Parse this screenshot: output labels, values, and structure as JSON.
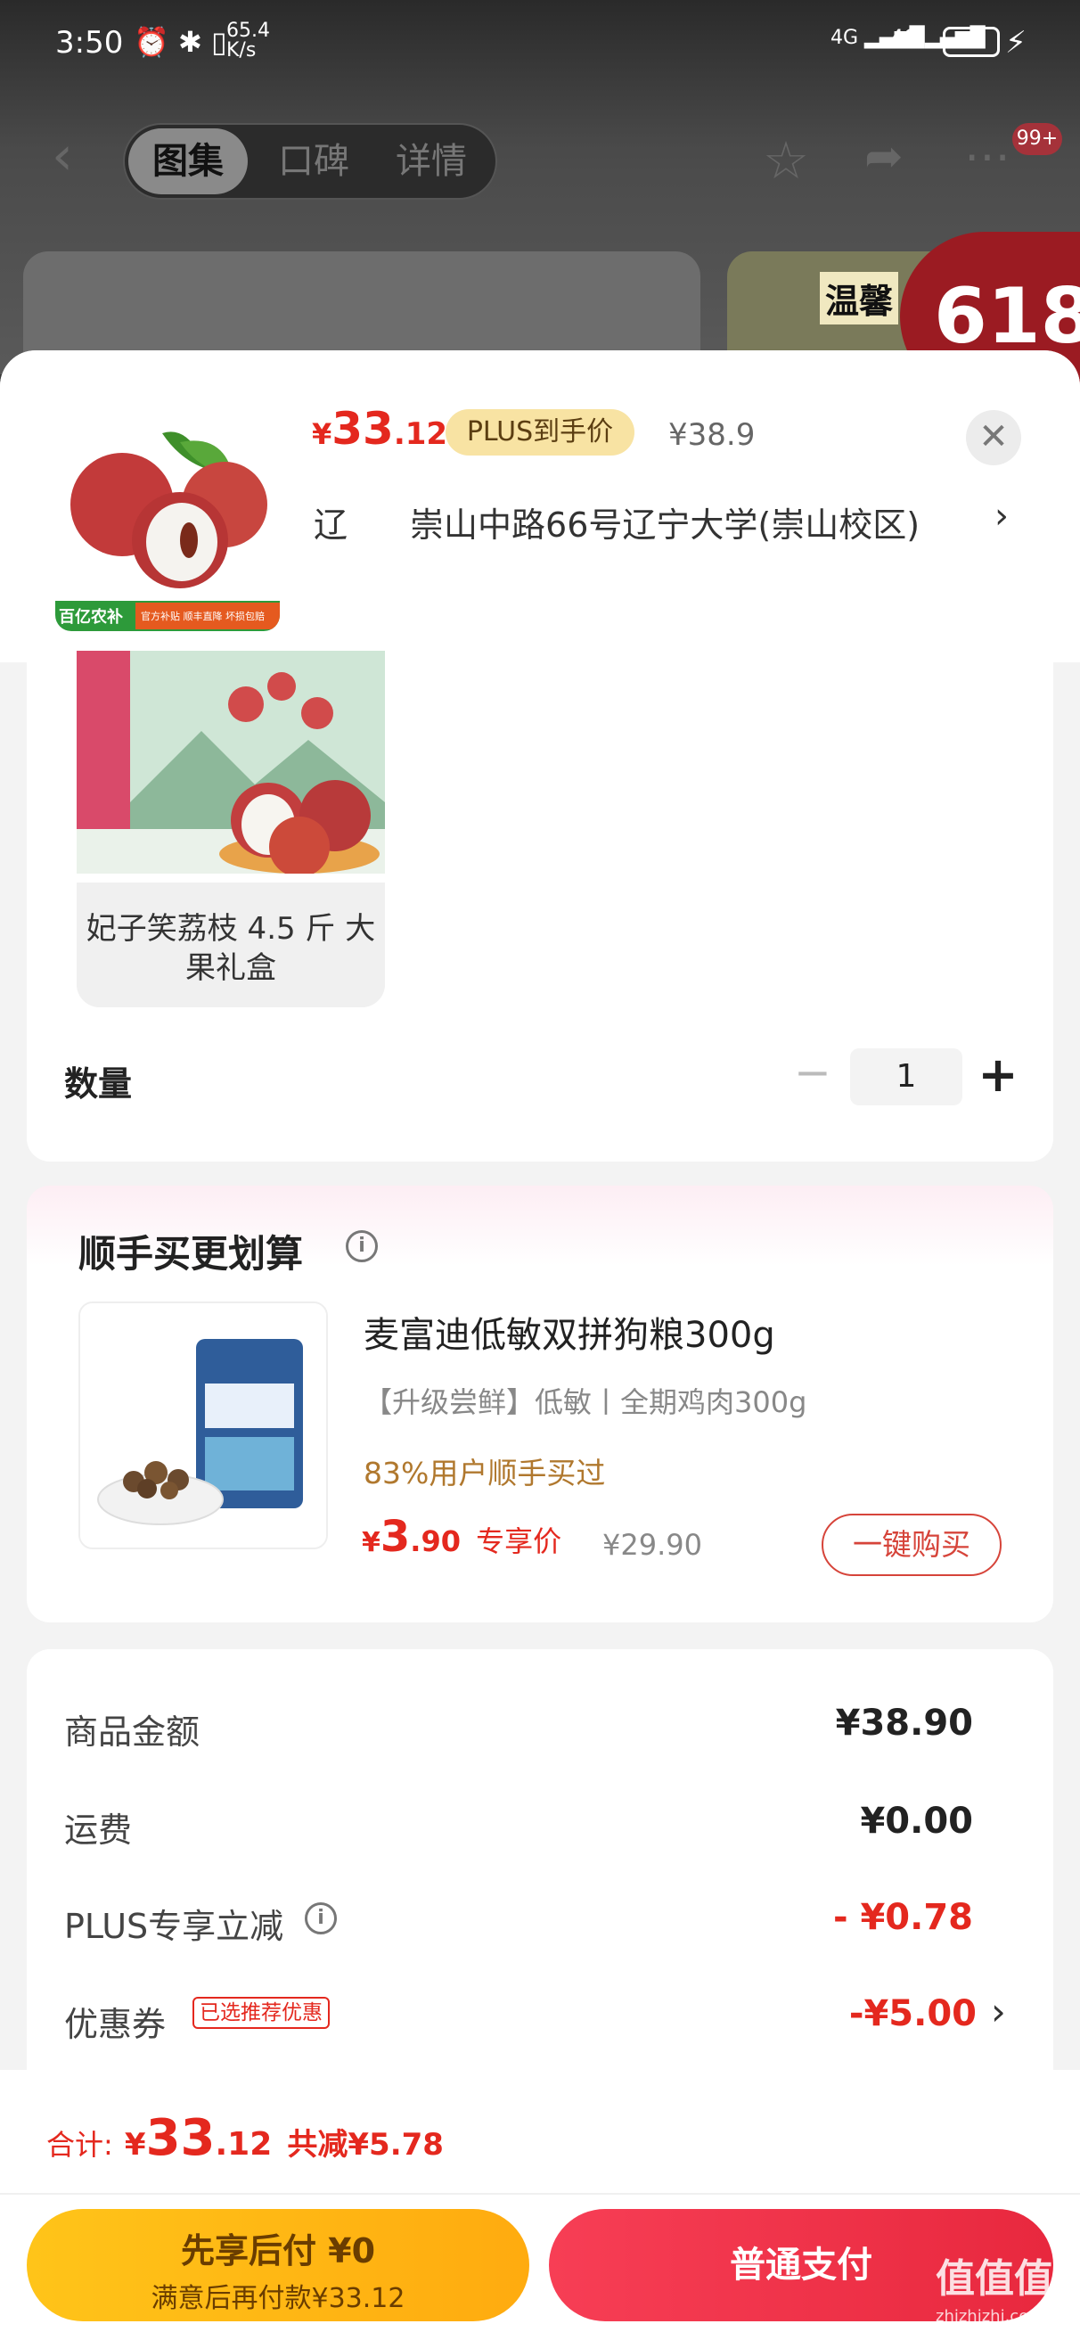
{
  "status_bar": {
    "time": "3:50",
    "speed": "65.4",
    "speed_unit": "K/s",
    "net1": "4G",
    "net2": "4G",
    "battery": "46"
  },
  "top_nav": {
    "tabs": [
      {
        "label": "图集"
      },
      {
        "label": "口碑"
      },
      {
        "label": "详情"
      }
    ],
    "badge": "99+",
    "promo_text": "温馨",
    "promo_618": "618"
  },
  "product": {
    "price_symbol": "¥",
    "price_int": "33",
    "price_dec": ".12",
    "plus_label": "PLUS到手价",
    "original_price": "¥38.9",
    "address_prefix": "辽",
    "address": "崇山中路66号辽宁大学(崇山校区)",
    "image_badge": "百亿农补",
    "image_badge2": "官方补贴 顺丰直降 坏损包赔"
  },
  "spec": {
    "name": "妃子笑荔枝 4.5 斤 大果礼盒"
  },
  "quantity": {
    "label": "数量",
    "value": "1",
    "minus": "−",
    "plus": "+"
  },
  "upsell": {
    "title": "顺手买更划算",
    "item": {
      "name": "麦富迪低敏双拼狗粮300g",
      "subtitle": "【升级尝鲜】低敏丨全期鸡肉300g",
      "bought": "83%用户顺手买过",
      "price_symbol": "¥",
      "price_int": "3",
      "price_dec": ".90",
      "price_tag": "专享价",
      "original": "¥29.90",
      "buy_button": "一键购买"
    }
  },
  "summary": {
    "goods_label": "商品金额",
    "goods_value": "¥38.90",
    "shipping_label": "运费",
    "shipping_value": "¥0.00",
    "plus_label": "PLUS专享立减",
    "plus_value": "- ¥0.78",
    "coupon_label": "优惠券",
    "coupon_tag": "已选推荐优惠",
    "coupon_value": "-¥5.00"
  },
  "footer": {
    "total_label": "合计:",
    "total_symbol": "¥",
    "total_int": "33",
    "total_dec": ".12",
    "saved": "共减¥5.78",
    "bnpl_title": "先享后付 ¥0",
    "bnpl_sub": "满意后再付款¥33.12",
    "pay_button": "普通支付"
  },
  "watermark": {
    "text": "值值值",
    "domain": "zhizhizhi.com"
  },
  "colors": {
    "accent_red": "#e4281e",
    "bnpl_yellow": "#ffb914",
    "pay_red": "#f0334a",
    "plus_gold": "#f8e3a3"
  }
}
